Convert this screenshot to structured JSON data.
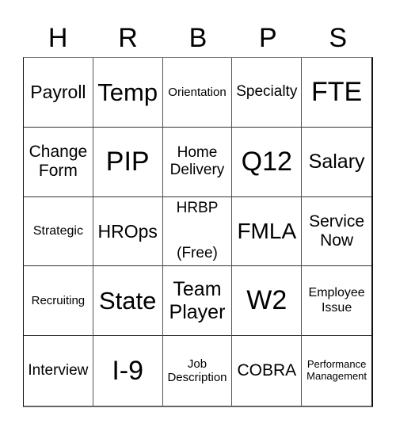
{
  "header": {
    "letters": [
      "H",
      "R",
      "B",
      "P",
      "S"
    ]
  },
  "board": {
    "rows": [
      [
        "Payroll",
        "Temp",
        "Orientation",
        "Specialty",
        "FTE"
      ],
      [
        "Change\nForm",
        "PIP",
        "Home\nDelivery",
        "Q12",
        "Salary"
      ],
      [
        "Strategic",
        "HROps",
        "HRBP\n\n(Free)",
        "FMLA",
        "Service\nNow"
      ],
      [
        "Recruiting",
        "State",
        "Team\nPlayer",
        "W2",
        "Employee\nIssue"
      ],
      [
        "Interview",
        "I-9",
        "Job\nDescription",
        "COBRA",
        "Performance\nManagement"
      ]
    ]
  }
}
